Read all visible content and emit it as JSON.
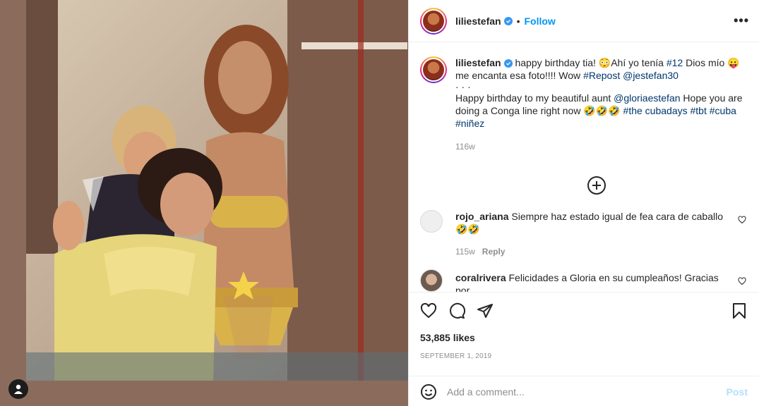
{
  "post": {
    "username": "liliestefan",
    "follow_label": "Follow",
    "separator": "•",
    "more_label": "•••"
  },
  "caption": {
    "username": "liliestefan",
    "line1_a": " happy birthday tia! 😳Ahí yo tenía ",
    "tag_12": "#12",
    "line1_b": " Dios mío 😛 me encanta esa foto!!!! Wow ",
    "tag_repost": "#Repost",
    "mention_jestefan": "@jestefan30",
    "dots": "·  ·  ·",
    "line2_a": "Happy birthday to my beautiful aunt ",
    "mention_gloria": "@gloriaestefan",
    "line2_b": " Hope you are doing a Conga line right now 🤣🤣🤣 ",
    "tag_cubadays": "#the cubadays",
    "tag_tbt": "#tbt",
    "tag_cuba": "#cuba",
    "tag_ninez": "#niñez",
    "time": "116w"
  },
  "comments": [
    {
      "username": "rojo_ariana",
      "text": " Siempre haz estado igual de fea cara de caballo",
      "emoji": "🤣🤣",
      "time": "115w",
      "reply_label": "Reply"
    },
    {
      "username": "coralrivera",
      "text": " Felicidades a Gloria en su cumpleaños! Gracias por"
    }
  ],
  "engagement": {
    "likes": "53,885 likes",
    "date": "SEPTEMBER 1, 2019"
  },
  "composer": {
    "placeholder": "Add a comment...",
    "post_label": "Post"
  },
  "colors": {
    "link": "#00376b",
    "follow": "#0095f6",
    "post_disabled": "#b2dffc",
    "verified": "#3897f0"
  },
  "icons": [
    "heart-icon",
    "comment-icon",
    "share-icon",
    "bookmark-icon",
    "emoji-icon",
    "plus-circle-icon",
    "verified-icon",
    "user-icon"
  ]
}
